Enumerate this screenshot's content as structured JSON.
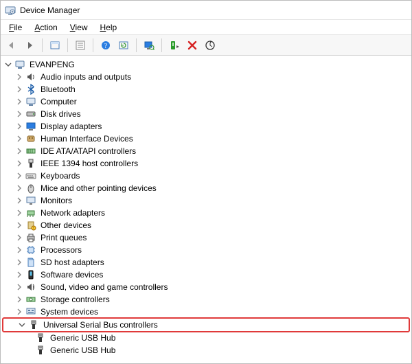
{
  "window": {
    "title": "Device Manager"
  },
  "menubar": {
    "file": "File",
    "action": "Action",
    "view": "View",
    "help": "Help"
  },
  "toolbar_icons": {
    "back": "back-arrow-icon",
    "forward": "forward-arrow-icon",
    "show_hidden": "show-hidden-icon",
    "properties": "properties-icon",
    "help": "help-icon",
    "refresh": "refresh-icon",
    "monitor": "scan-hardware-icon",
    "add_legacy": "add-legacy-icon",
    "delete": "uninstall-icon",
    "update_driver": "update-driver-icon"
  },
  "tree": {
    "root": {
      "label": "EVANPENG",
      "expanded": true
    },
    "categories": [
      {
        "label": "Audio inputs and outputs",
        "icon": "speaker-icon"
      },
      {
        "label": "Bluetooth",
        "icon": "bluetooth-icon"
      },
      {
        "label": "Computer",
        "icon": "computer-icon"
      },
      {
        "label": "Disk drives",
        "icon": "disk-icon"
      },
      {
        "label": "Display adapters",
        "icon": "display-adapter-icon"
      },
      {
        "label": "Human Interface Devices",
        "icon": "hid-icon"
      },
      {
        "label": "IDE ATA/ATAPI controllers",
        "icon": "ide-icon"
      },
      {
        "label": "IEEE 1394 host controllers",
        "icon": "firewire-icon"
      },
      {
        "label": "Keyboards",
        "icon": "keyboard-icon"
      },
      {
        "label": "Mice and other pointing devices",
        "icon": "mouse-icon"
      },
      {
        "label": "Monitors",
        "icon": "monitor-icon"
      },
      {
        "label": "Network adapters",
        "icon": "network-icon"
      },
      {
        "label": "Other devices",
        "icon": "other-icon"
      },
      {
        "label": "Print queues",
        "icon": "printer-icon"
      },
      {
        "label": "Processors",
        "icon": "processor-icon"
      },
      {
        "label": "SD host adapters",
        "icon": "sd-icon"
      },
      {
        "label": "Software devices",
        "icon": "software-icon"
      },
      {
        "label": "Sound, video and game controllers",
        "icon": "sound-icon"
      },
      {
        "label": "Storage controllers",
        "icon": "storage-icon"
      },
      {
        "label": "System devices",
        "icon": "system-icon"
      }
    ],
    "usb": {
      "label": "Universal Serial Bus controllers",
      "icon": "usb-icon",
      "expanded": true,
      "highlighted": true,
      "children": [
        {
          "label": "Generic USB Hub",
          "icon": "usb-icon"
        },
        {
          "label": "Generic USB Hub",
          "icon": "usb-icon"
        }
      ]
    }
  }
}
